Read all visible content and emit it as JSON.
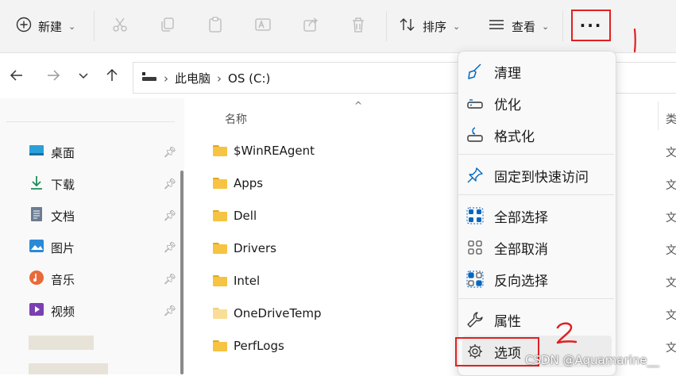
{
  "toolbar": {
    "new_label": "新建",
    "sort_label": "排序",
    "view_label": "查看",
    "more_label": "···",
    "icons": [
      "plus-circle-icon",
      "scissors-icon",
      "copy-icon",
      "paste-icon",
      "rename-icon",
      "share-icon",
      "delete-icon",
      "sort-icon",
      "view-icon"
    ]
  },
  "address": {
    "crumb_pc": "此电脑",
    "crumb_drive": "OS (C:)"
  },
  "sidebar": {
    "items": [
      {
        "label": "桌面",
        "icon": "desktop-icon"
      },
      {
        "label": "下载",
        "icon": "download-icon"
      },
      {
        "label": "文档",
        "icon": "document-icon"
      },
      {
        "label": "图片",
        "icon": "picture-icon"
      },
      {
        "label": "音乐",
        "icon": "music-icon"
      },
      {
        "label": "视频",
        "icon": "video-icon"
      }
    ]
  },
  "content": {
    "col_name": "名称",
    "col_type": "类",
    "files": [
      {
        "name": "$WinREAgent",
        "type": "文"
      },
      {
        "name": "Apps",
        "type": "文"
      },
      {
        "name": "Dell",
        "type": "文"
      },
      {
        "name": "Drivers",
        "type": "文"
      },
      {
        "name": "Intel",
        "type": "文"
      },
      {
        "name": "OneDriveTemp",
        "type": "文"
      },
      {
        "name": "PerfLogs",
        "type": "文"
      }
    ]
  },
  "menu": {
    "items": [
      {
        "label": "清理",
        "icon": "broom-icon"
      },
      {
        "label": "优化",
        "icon": "optimize-drive-icon"
      },
      {
        "label": "格式化",
        "icon": "format-drive-icon"
      },
      {
        "label": "固定到快速访问",
        "icon": "pin-icon"
      },
      {
        "label": "全部选择",
        "icon": "select-all-icon"
      },
      {
        "label": "全部取消",
        "icon": "select-none-icon"
      },
      {
        "label": "反向选择",
        "icon": "invert-selection-icon"
      },
      {
        "label": "属性",
        "icon": "wrench-icon"
      },
      {
        "label": "选项",
        "icon": "gear-icon"
      }
    ]
  },
  "annotations": {
    "mark1": "1",
    "mark2": "2"
  },
  "watermark": "CSDN @Aquamarine__",
  "colors": {
    "annotation_red": "#e02020",
    "accent_blue": "#0067c0",
    "folder_yellow": "#f6c343"
  }
}
